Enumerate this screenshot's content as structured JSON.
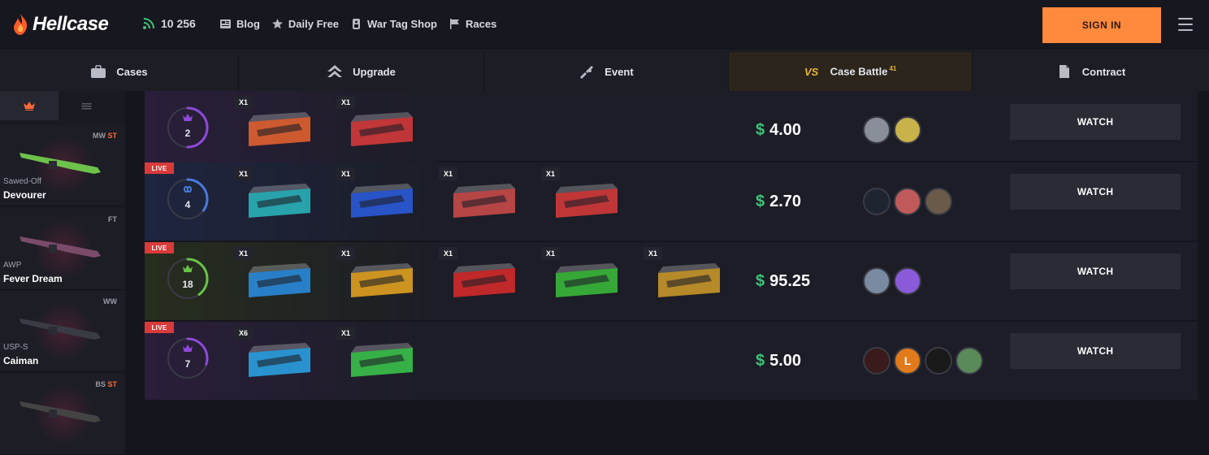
{
  "header": {
    "logo_text": "Hellcase",
    "online_count": "10 256",
    "nav": [
      {
        "label": "Blog",
        "icon": "blog-icon"
      },
      {
        "label": "Daily Free",
        "icon": "star-icon"
      },
      {
        "label": "War Tag Shop",
        "icon": "tag-icon"
      },
      {
        "label": "Races",
        "icon": "flag-icon"
      }
    ],
    "signin_label": "SIGN IN"
  },
  "tabs": [
    {
      "label": "Cases",
      "icon": "briefcase-icon",
      "active": false
    },
    {
      "label": "Upgrade",
      "icon": "upgrade-arrow-icon",
      "active": false
    },
    {
      "label": "Event",
      "icon": "event-icon",
      "active": false
    },
    {
      "label": "Case Battle",
      "icon": "vs-icon",
      "badge": "41",
      "active": true
    },
    {
      "label": "Contract",
      "icon": "document-icon",
      "active": false
    }
  ],
  "sidebar": {
    "drops": [
      {
        "condition": "MW",
        "stattrak": "ST",
        "type": "Sawed-Off",
        "name": "Devourer",
        "gun_color": "#6cc24a"
      },
      {
        "condition": "FT",
        "stattrak": "",
        "type": "AWP",
        "name": "Fever Dream",
        "gun_color": "#7a4c6a"
      },
      {
        "condition": "WW",
        "stattrak": "",
        "type": "USP-S",
        "name": "Caiman",
        "gun_color": "#3a3b45"
      },
      {
        "condition": "BS",
        "stattrak": "ST",
        "type": "",
        "name": "",
        "gun_color": "#444"
      }
    ]
  },
  "battles": [
    {
      "live": false,
      "live_label": "",
      "players_count": "2",
      "ring_color": "#8e4ad9",
      "ring_fill": 0.5,
      "icon": "crown-icon",
      "band": "#2a1e3a",
      "cases": [
        {
          "mult": "X1",
          "color": "#e06030"
        },
        {
          "mult": "X1",
          "color": "#d33a3a"
        }
      ],
      "price": "4.00",
      "players": [
        {
          "initial": "",
          "color": "#8a8e98"
        },
        {
          "initial": "",
          "color": "#c8b24a"
        }
      ],
      "watch_label": "WATCH"
    },
    {
      "live": true,
      "live_label": "LIVE",
      "players_count": "4",
      "ring_color": "#4a7bd9",
      "ring_fill": 0.35,
      "icon": "infinity-icon",
      "band": "#1e2540",
      "cases": [
        {
          "mult": "X1",
          "color": "#2ab0b8"
        },
        {
          "mult": "X1",
          "color": "#2a5ad9"
        },
        {
          "mult": "X1",
          "color": "#c84a4a"
        },
        {
          "mult": "X1",
          "color": "#d33a3a"
        }
      ],
      "price": "2.70",
      "players": [
        {
          "initial": "",
          "color": "#1e2530"
        },
        {
          "initial": "",
          "color": "#c05a5a"
        },
        {
          "initial": "",
          "color": "#6a5a4a"
        }
      ],
      "watch_label": "WATCH"
    },
    {
      "live": true,
      "live_label": "LIVE",
      "players_count": "18",
      "ring_color": "#6ac24a",
      "ring_fill": 0.4,
      "icon": "crown-icon",
      "band": "#262e1e",
      "cases": [
        {
          "mult": "X1",
          "color": "#2a8ad9"
        },
        {
          "mult": "X1",
          "color": "#e0a020"
        },
        {
          "mult": "X1",
          "color": "#d32a2a"
        },
        {
          "mult": "X1",
          "color": "#3ab83a"
        },
        {
          "mult": "X1",
          "color": "#c8962a"
        }
      ],
      "price": "95.25",
      "players": [
        {
          "initial": "",
          "color": "#7a8aa0"
        },
        {
          "initial": "",
          "color": "#8a5ad9"
        }
      ],
      "watch_label": "WATCH"
    },
    {
      "live": true,
      "live_label": "LIVE",
      "players_count": "7",
      "ring_color": "#8e4ad9",
      "ring_fill": 0.3,
      "icon": "crown-icon",
      "band": "#2a1e3a",
      "cases": [
        {
          "mult": "X6",
          "color": "#2aa0e0"
        },
        {
          "mult": "X1",
          "color": "#3ac24a"
        }
      ],
      "price": "5.00",
      "players": [
        {
          "initial": "",
          "color": "#3a1a1a"
        },
        {
          "initial": "L",
          "color": "#e07a1a"
        },
        {
          "initial": "",
          "color": "#1a1a1a"
        },
        {
          "initial": "",
          "color": "#5a8a5a"
        }
      ],
      "watch_label": "WATCH"
    }
  ]
}
